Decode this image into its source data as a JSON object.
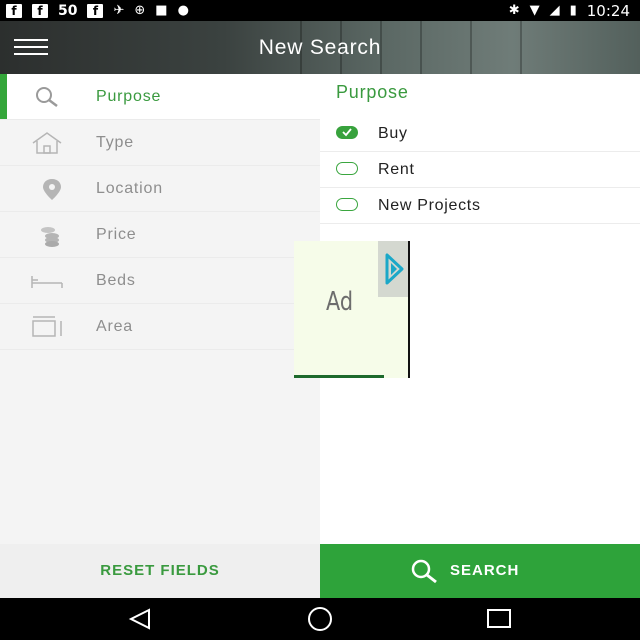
{
  "status_bar": {
    "left_icons": [
      "facebook-icon",
      "facebook-icon",
      "facebook-icon",
      "satellite-icon",
      "sync-icon",
      "lock-icon",
      "android-icon"
    ],
    "temp_label": "50",
    "time": "10:24",
    "right_icons": [
      "bluetooth-icon",
      "wifi-icon",
      "no-signal-icon",
      "battery-charging-icon"
    ]
  },
  "app_bar": {
    "title": "New Search",
    "menu_icon": "hamburger-menu-icon"
  },
  "sidebar": {
    "items": [
      {
        "label": "Purpose",
        "icon": "search-icon",
        "active": true
      },
      {
        "label": "Type",
        "icon": "home-icon",
        "active": false
      },
      {
        "label": "Location",
        "icon": "location-pin-icon",
        "active": false
      },
      {
        "label": "Price",
        "icon": "coins-icon",
        "active": false
      },
      {
        "label": "Beds",
        "icon": "bed-icon",
        "active": false
      },
      {
        "label": "Area",
        "icon": "area-icon",
        "active": false
      }
    ]
  },
  "panel": {
    "title": "Purpose",
    "options": [
      {
        "label": "Buy",
        "selected": true
      },
      {
        "label": "Rent",
        "selected": false
      },
      {
        "label": "New Projects",
        "selected": false
      }
    ]
  },
  "ad": {
    "label": "Ad",
    "icon": "ad-choices-icon"
  },
  "buttons": {
    "reset_label": "RESET FIELDS",
    "search_label": "SEARCH"
  },
  "nav_bar": {
    "icons": [
      "back-icon",
      "home-circle-icon",
      "recents-icon"
    ]
  },
  "colors": {
    "accent": "#34a63a",
    "accent_text": "#3a9a3f",
    "search_button": "#2ea33a"
  }
}
